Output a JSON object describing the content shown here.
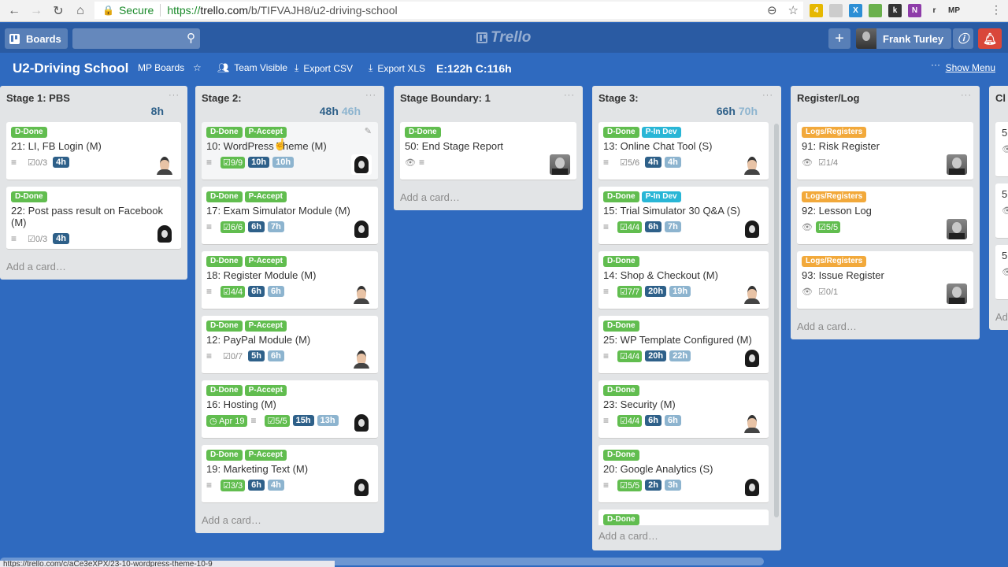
{
  "browser": {
    "secure_label": "Secure",
    "url_prefix": "https://",
    "url_domain": "trello.com",
    "url_path": "/b/TIFVAJH8/u2-driving-school",
    "extensions": [
      {
        "name": "ext-yellow",
        "text": "4",
        "color": "#e6b800"
      },
      {
        "name": "ext-drive",
        "text": "",
        "color": "#cccccc"
      },
      {
        "name": "ext-x",
        "text": "X",
        "color": "#2d8fd5"
      },
      {
        "name": "ext-green",
        "text": "",
        "color": "#6ab04c"
      },
      {
        "name": "ext-k",
        "text": "k",
        "color": "#333333"
      },
      {
        "name": "ext-onenote",
        "text": "N",
        "color": "#8e3ca9"
      },
      {
        "name": "ext-r",
        "text": "r",
        "color": "#f2f2f2"
      },
      {
        "name": "ext-mp",
        "text": "MP",
        "color": "#f2f2f2"
      }
    ],
    "status_url": "https://trello.com/c/aCe3eXPX/23-10-wordpress-theme-10-9"
  },
  "header": {
    "boards_label": "Boards",
    "search_placeholder": "",
    "logo_text": "Trello",
    "user_name": "Frank Turley"
  },
  "board": {
    "title": "U2-Driving School",
    "mp_boards": "MP Boards",
    "visibility": "Team Visible",
    "export_csv": "Export CSV",
    "export_xls": "Export XLS",
    "estimate_summary": "E:122h C:116h",
    "show_menu": "Show Menu",
    "add_card": "Add a card…"
  },
  "colors": {
    "d_done": "#61bd4f",
    "p_accept": "#61bd4f",
    "p_in_dev": "#29b6d6",
    "logs": "#f2a93b",
    "estimate": "#2e6089",
    "consumed": "#8db4cf"
  },
  "lists": [
    {
      "title": "Stage 1: PBS",
      "est": "8h",
      "con": "",
      "cards": [
        {
          "labels": [
            "D-Done"
          ],
          "title": "21: LI, FB Login (M)",
          "desc": true,
          "check": "0/3",
          "check_done": false,
          "est": "4h",
          "con": "",
          "avatar": "man"
        },
        {
          "labels": [
            "D-Done"
          ],
          "title": "22: Post pass result on Facebook (M)",
          "desc": true,
          "check": "0/3",
          "check_done": false,
          "est": "4h",
          "con": "",
          "avatar": "woman"
        }
      ]
    },
    {
      "title": "Stage 2:",
      "est": "48h",
      "con": "46h",
      "cards": [
        {
          "labels": [
            "D-Done",
            "P-Accept"
          ],
          "title": "10: WordPress Theme (M)",
          "desc": true,
          "check": "9/9",
          "check_done": true,
          "est": "10h",
          "con": "10h",
          "avatar": "woman",
          "hover": true
        },
        {
          "labels": [
            "D-Done",
            "P-Accept"
          ],
          "title": "17: Exam Simulator Module (M)",
          "desc": true,
          "check": "6/6",
          "check_done": true,
          "est": "6h",
          "con": "7h",
          "avatar": "woman"
        },
        {
          "labels": [
            "D-Done",
            "P-Accept"
          ],
          "title": "18: Register Module (M)",
          "desc": true,
          "check": "4/4",
          "check_done": true,
          "est": "6h",
          "con": "6h",
          "avatar": "man"
        },
        {
          "labels": [
            "D-Done",
            "P-Accept"
          ],
          "title": "12: PayPal Module (M)",
          "desc": true,
          "check": "0/7",
          "check_done": false,
          "est": "5h",
          "con": "6h",
          "avatar": "man"
        },
        {
          "labels": [
            "D-Done",
            "P-Accept"
          ],
          "title": "16: Hosting (M)",
          "due": "Apr 19",
          "desc": true,
          "check": "5/5",
          "check_done": true,
          "est": "15h",
          "con": "13h",
          "avatar": "woman"
        },
        {
          "labels": [
            "D-Done",
            "P-Accept"
          ],
          "title": "19: Marketing Text (M)",
          "desc": true,
          "check": "3/3",
          "check_done": true,
          "est": "6h",
          "con": "4h",
          "avatar": "woman"
        }
      ]
    },
    {
      "title": "Stage Boundary: 1",
      "est": "",
      "con": "",
      "cards": [
        {
          "labels": [
            "D-Done"
          ],
          "title": "50: End Stage Report",
          "watch": true,
          "desc": true,
          "check": "",
          "est": "",
          "con": "",
          "avatar": "boss"
        }
      ]
    },
    {
      "title": "Stage 3:",
      "est": "66h",
      "con": "70h",
      "cards": [
        {
          "labels": [
            "D-Done",
            "P-In Dev"
          ],
          "title": "13: Online Chat Tool (S)",
          "desc": true,
          "check": "5/6",
          "check_done": false,
          "est": "4h",
          "con": "4h",
          "avatar": "man"
        },
        {
          "labels": [
            "D-Done",
            "P-In Dev"
          ],
          "title": "15: Trial Simulator 30 Q&A (S)",
          "desc": true,
          "check": "4/4",
          "check_done": true,
          "est": "6h",
          "con": "7h",
          "avatar": "woman"
        },
        {
          "labels": [
            "D-Done"
          ],
          "title": "14: Shop & Checkout (M)",
          "desc": true,
          "check": "7/7",
          "check_done": true,
          "est": "20h",
          "con": "19h",
          "avatar": "man"
        },
        {
          "labels": [
            "D-Done"
          ],
          "title": "25: WP Template Configured (M)",
          "desc": true,
          "check": "4/4",
          "check_done": true,
          "est": "20h",
          "con": "22h",
          "avatar": "woman"
        },
        {
          "labels": [
            "D-Done"
          ],
          "title": "23: Security (M)",
          "desc": true,
          "check": "4/4",
          "check_done": true,
          "est": "6h",
          "con": "6h",
          "avatar": "man"
        },
        {
          "labels": [
            "D-Done"
          ],
          "title": "20: Google Analytics (S)",
          "desc": true,
          "check": "5/5",
          "check_done": true,
          "est": "2h",
          "con": "3h",
          "avatar": "woman"
        },
        {
          "labels": [
            "D-Done"
          ],
          "title": "",
          "partial": true
        }
      ]
    },
    {
      "title": "Register/Log",
      "est": "",
      "con": "",
      "cards": [
        {
          "labels": [
            "Logs/Registers"
          ],
          "title": "91: Risk Register",
          "watch": true,
          "check": "1/4",
          "check_done": false,
          "est": "",
          "con": "",
          "avatar": "boss"
        },
        {
          "labels": [
            "Logs/Registers"
          ],
          "title": "92: Lesson Log",
          "watch": true,
          "check": "5/5",
          "check_done": true,
          "est": "",
          "con": "",
          "avatar": "boss"
        },
        {
          "labels": [
            "Logs/Registers"
          ],
          "title": "93: Issue Register",
          "watch": true,
          "check": "0/1",
          "check_done": false,
          "est": "",
          "con": "",
          "avatar": "boss"
        }
      ]
    },
    {
      "title": "Cl",
      "est": "",
      "con": "",
      "cards": [
        {
          "labels": [],
          "title": "5",
          "watch": true
        },
        {
          "labels": [],
          "title": "5",
          "watch": true
        },
        {
          "labels": [],
          "title": "5",
          "watch": true
        }
      ]
    }
  ]
}
